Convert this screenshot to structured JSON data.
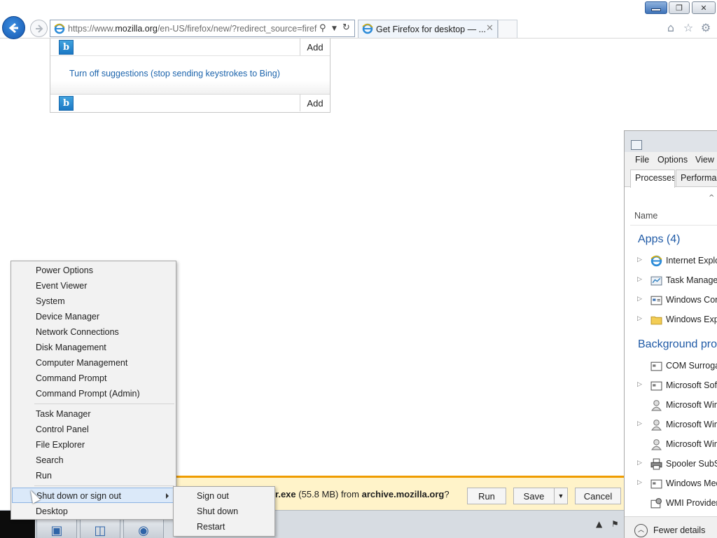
{
  "browser": {
    "address": {
      "url_prefix": "https://www.",
      "url_domain": "mozilla.org",
      "url_rest": "/en-US/firefox/new/?redirect_source=firefc"
    },
    "tab": {
      "title": "Get Firefox for desktop — ...",
      "close": "✕"
    }
  },
  "bing_suggestions": {
    "add_label_1": "Add",
    "add_label_2": "Add",
    "turn_off_link": "Turn off suggestions (stop sending keystrokes to Bing)",
    "logo_letter": "b"
  },
  "download_bar": {
    "file_tail": "r.exe",
    "size": "(55.8 MB)",
    "from_text": "from",
    "source": "archive.mozilla.org",
    "question": "?",
    "run_label": "Run",
    "save_label": "Save",
    "cancel_label": "Cancel"
  },
  "task_manager": {
    "menu": [
      "File",
      "Options",
      "View"
    ],
    "tabs": [
      "Processes",
      "Performar"
    ],
    "column_name": "Name",
    "apps_header": "Apps (4)",
    "apps": [
      {
        "name": "Internet Explor",
        "icon": "ie-icon"
      },
      {
        "name": "Task Manager",
        "icon": "taskmanager-icon"
      },
      {
        "name": "Windows Con",
        "icon": "console-icon"
      },
      {
        "name": "Windows Expl",
        "icon": "folder-icon"
      }
    ],
    "bg_header": "Background proc",
    "background": [
      {
        "name": "COM Surrogat",
        "icon": "window-icon"
      },
      {
        "name": "Microsoft Soft",
        "icon": "window-icon"
      },
      {
        "name": "Microsoft Win",
        "icon": "user-icon"
      },
      {
        "name": "Microsoft Win",
        "icon": "user-icon"
      },
      {
        "name": "Microsoft Win",
        "icon": "user-icon"
      },
      {
        "name": "Spooler SubSy",
        "icon": "printer-icon"
      },
      {
        "name": "Windows Med",
        "icon": "window-icon"
      },
      {
        "name": "WMI Provider",
        "icon": "gears-icon"
      }
    ],
    "fewer_details": "Fewer details"
  },
  "winx_menu": {
    "group1": [
      "Power Options",
      "Event Viewer",
      "System",
      "Device Manager",
      "Network Connections",
      "Disk Management",
      "Computer Management",
      "Command Prompt",
      "Command Prompt (Admin)"
    ],
    "group2": [
      "Task Manager",
      "Control Panel",
      "File Explorer",
      "Search",
      "Run"
    ],
    "shutdown": "Shut down or sign out",
    "desktop": "Desktop",
    "submenu": [
      "Sign out",
      "Shut down",
      "Restart"
    ]
  }
}
